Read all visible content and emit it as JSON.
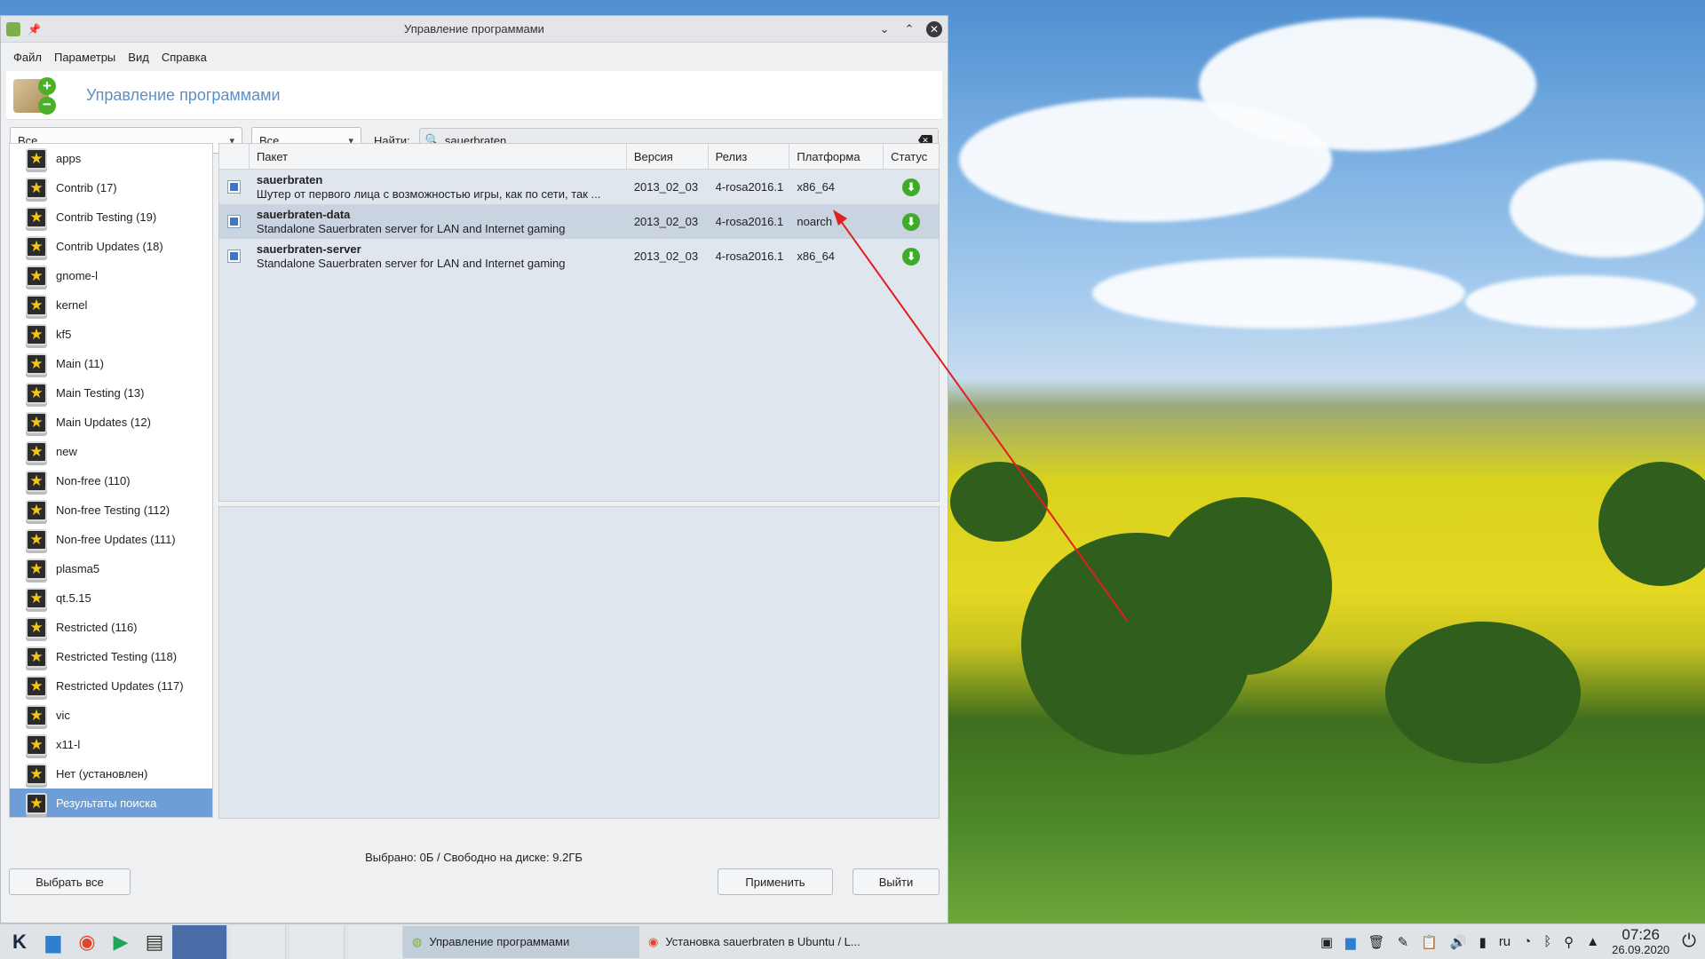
{
  "window": {
    "title": "Управление программами",
    "header_title": "Управление программами"
  },
  "menu": [
    "Файл",
    "Параметры",
    "Вид",
    "Справка"
  ],
  "filters": {
    "group_select": "Все",
    "state_select": "Все",
    "find_label": "Найти:",
    "search_value": "sauerbraten"
  },
  "sidebar": {
    "items": [
      "apps",
      "Contrib (17)",
      "Contrib Testing (19)",
      "Contrib Updates (18)",
      "gnome-l",
      "kernel",
      "kf5",
      "Main (11)",
      "Main Testing (13)",
      "Main Updates (12)",
      "new",
      "Non-free (110)",
      "Non-free Testing (112)",
      "Non-free Updates (111)",
      "plasma5",
      "qt.5.15",
      "Restricted (116)",
      "Restricted Testing (118)",
      "Restricted Updates (117)",
      "vic",
      "x11-l",
      "Нет (установлен)",
      "Результаты поиска"
    ],
    "selected_index": 22
  },
  "table": {
    "columns": [
      "Пакет",
      "Версия",
      "Релиз",
      "Платформа",
      "Статус"
    ],
    "rows": [
      {
        "name": "sauerbraten",
        "summary": "Шутер от первого лица с возможностью игры, как по сети, так ...",
        "version": "2013_02_03",
        "release": "4-rosa2016.1",
        "platform": "x86_64",
        "status_icon": "download-icon"
      },
      {
        "name": "sauerbraten-data",
        "summary": "Standalone Sauerbraten server for LAN and Internet gaming",
        "version": "2013_02_03",
        "release": "4-rosa2016.1",
        "platform": "noarch",
        "status_icon": "download-icon"
      },
      {
        "name": "sauerbraten-server",
        "summary": "Standalone Sauerbraten server for LAN and Internet gaming",
        "version": "2013_02_03",
        "release": "4-rosa2016.1",
        "platform": "x86_64",
        "status_icon": "download-icon"
      }
    ]
  },
  "status_line": "Выбрано: 0Б / Свободно на диске: 9.2ГБ",
  "buttons": {
    "select_all": "Выбрать все",
    "apply": "Применить",
    "quit": "Выйти"
  },
  "taskbar": {
    "tasks": [
      "Управление программами",
      "Установка sauerbraten в Ubuntu / L..."
    ],
    "keyboard_layout": "ru",
    "time": "07:26",
    "date": "26.09.2020"
  },
  "colors": {
    "accent": "#6d9ed7",
    "header_title": "#5b8fc7",
    "download_green": "#3eab2a",
    "annotation_arrow": "#e02020"
  }
}
